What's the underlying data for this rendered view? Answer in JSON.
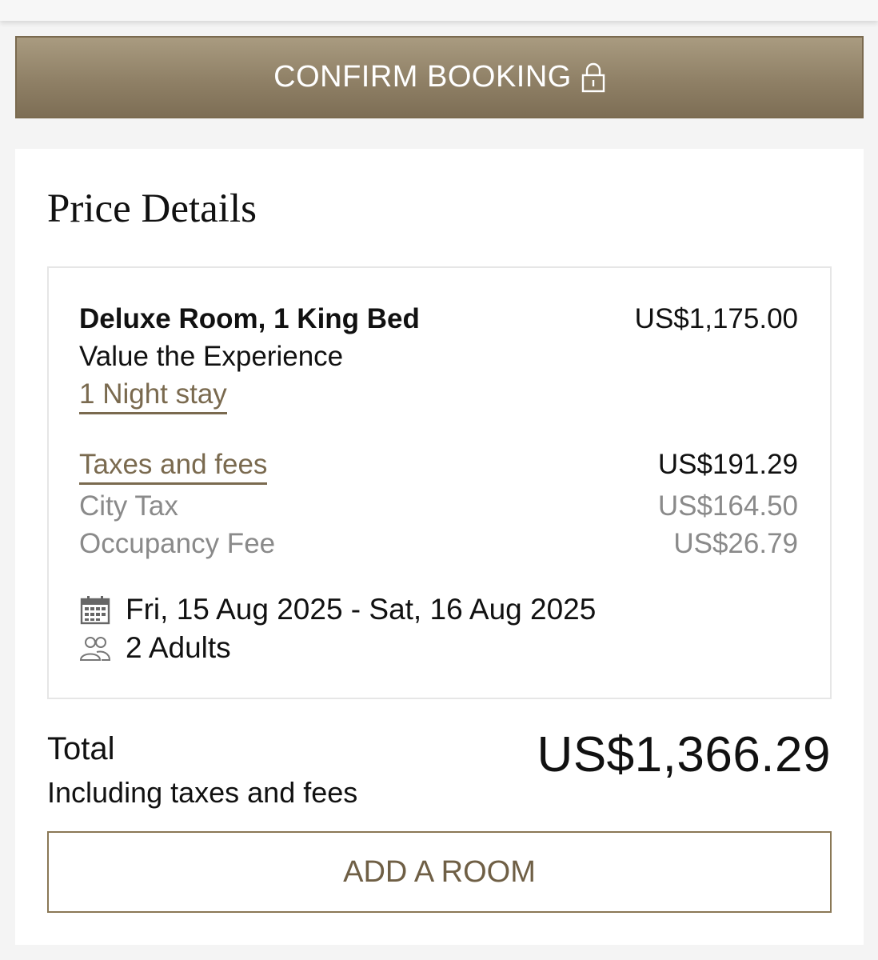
{
  "header": {
    "confirm_label": "CONFIRM BOOKING",
    "lock_icon": "lock-icon"
  },
  "price_details": {
    "title": "Price Details",
    "room": {
      "name": "Deluxe Room, 1 King Bed",
      "rate_name": "Value the Experience",
      "stay_link": "1 Night stay",
      "price": "US$1,175.00"
    },
    "taxes": {
      "label": "Taxes and fees",
      "amount": "US$191.29",
      "items": [
        {
          "label": "City Tax",
          "amount": "US$164.50"
        },
        {
          "label": "Occupancy Fee",
          "amount": "US$26.79"
        }
      ]
    },
    "dates": "Fri, 15 Aug 2025 - Sat, 16 Aug 2025",
    "guests": "2 Adults"
  },
  "total": {
    "label": "Total",
    "sublabel": "Including taxes and fees",
    "amount": "US$1,366.29"
  },
  "add_room_label": "ADD A ROOM",
  "colors": {
    "gold": "#7a6a4f",
    "button_gradient_top": "#a99b80",
    "button_gradient_bottom": "#7d6e55"
  }
}
